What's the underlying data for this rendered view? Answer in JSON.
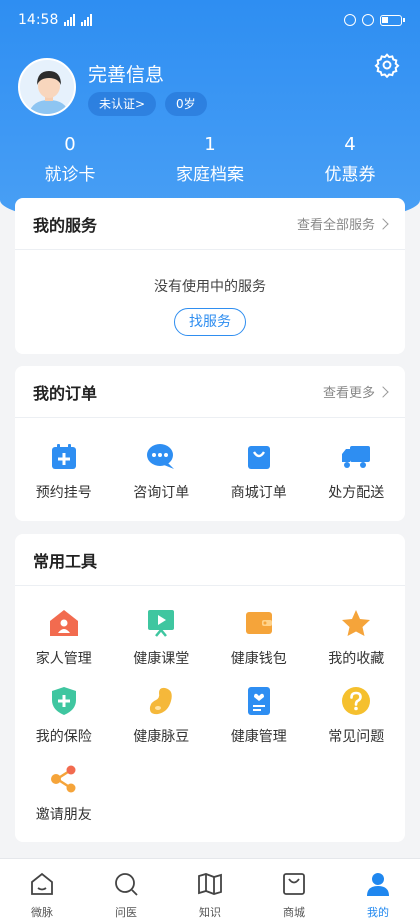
{
  "status": {
    "time": "14:58"
  },
  "profile": {
    "name": "完善信息",
    "auth_badge": "未认证>",
    "age_badge": "0岁"
  },
  "stats": [
    {
      "num": "0",
      "label": "就诊卡"
    },
    {
      "num": "1",
      "label": "家庭档案"
    },
    {
      "num": "4",
      "label": "优惠券"
    }
  ],
  "services": {
    "title": "我的服务",
    "more": "查看全部服务",
    "empty": "没有使用中的服务",
    "button": "找服务"
  },
  "orders": {
    "title": "我的订单",
    "more": "查看更多",
    "items": [
      {
        "label": "预约挂号",
        "icon": "calendar-plus-icon"
      },
      {
        "label": "咨询订单",
        "icon": "chat-bubble-icon"
      },
      {
        "label": "商城订单",
        "icon": "shopping-bag-icon"
      },
      {
        "label": "处方配送",
        "icon": "delivery-truck-icon"
      }
    ]
  },
  "tools": {
    "title": "常用工具",
    "items": [
      {
        "label": "家人管理",
        "icon": "family-house-icon"
      },
      {
        "label": "健康课堂",
        "icon": "video-class-icon"
      },
      {
        "label": "健康钱包",
        "icon": "wallet-icon"
      },
      {
        "label": "我的收藏",
        "icon": "star-icon"
      },
      {
        "label": "我的保险",
        "icon": "insurance-shield-icon"
      },
      {
        "label": "健康脉豆",
        "icon": "bean-icon"
      },
      {
        "label": "健康管理",
        "icon": "health-record-icon"
      },
      {
        "label": "常见问题",
        "icon": "question-icon"
      },
      {
        "label": "邀请朋友",
        "icon": "share-icon"
      }
    ]
  },
  "tabbar": [
    {
      "label": "微脉",
      "icon": "home-icon"
    },
    {
      "label": "问医",
      "icon": "search-doctor-icon"
    },
    {
      "label": "知识",
      "icon": "book-icon"
    },
    {
      "label": "商城",
      "icon": "shop-bag-icon"
    },
    {
      "label": "我的",
      "icon": "person-icon",
      "active": true
    }
  ],
  "colors": {
    "primary": "#2e8ef2",
    "active_tab": "#1f87ef"
  }
}
